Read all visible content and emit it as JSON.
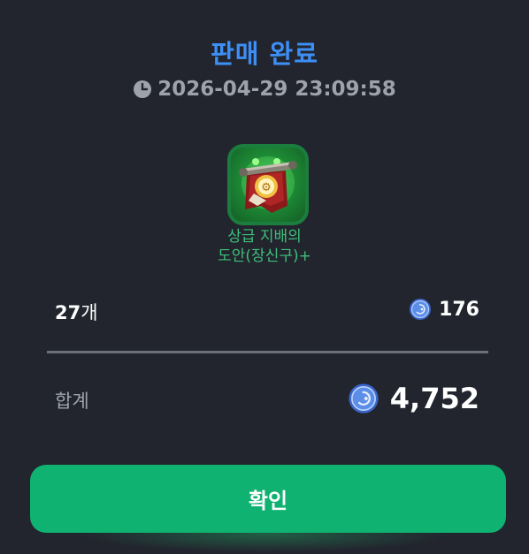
{
  "dialog": {
    "title": "판매 완료",
    "timestamp": "2026-04-29 23:09:58"
  },
  "item": {
    "icon": "guild-banner-scroll-icon",
    "name_line1": "상급 지배의",
    "name_line2": "도안(장신구)+",
    "frame_color": "#1b7e3e"
  },
  "sale": {
    "quantity": "27",
    "quantity_unit": "개",
    "unit_price": "176",
    "total_label": "합계",
    "total_value": "4,752"
  },
  "actions": {
    "confirm_label": "확인"
  },
  "colors": {
    "accent": "#3d8ff5",
    "confirm": "#0fb270",
    "item_name": "#3fbf7a",
    "background": "#22252e"
  }
}
